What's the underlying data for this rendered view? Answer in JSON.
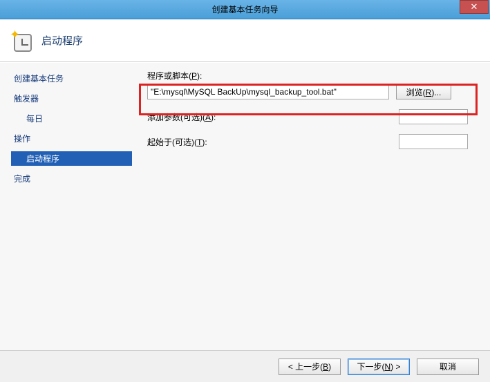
{
  "window": {
    "title": "创建基本任务向导"
  },
  "header": {
    "title": "启动程序"
  },
  "sidebar": {
    "items": [
      {
        "label": "创建基本任务"
      },
      {
        "label": "触发器"
      },
      {
        "label": "每日"
      },
      {
        "label": "操作"
      },
      {
        "label": "启动程序"
      },
      {
        "label": "完成"
      }
    ]
  },
  "content": {
    "program_label_pre": "程序或脚本(",
    "program_label_ak": "P",
    "program_label_post": "):",
    "program_value": "\"E:\\mysql\\MySQL BackUp\\mysql_backup_tool.bat\"",
    "browse_pre": "浏览(",
    "browse_ak": "R",
    "browse_post": ")...",
    "args_label_pre": "添加参数(可选)(",
    "args_label_ak": "A",
    "args_label_post": "):",
    "args_value": "",
    "startin_label_pre": "起始于(可选)(",
    "startin_label_ak": "T",
    "startin_label_post": "):",
    "startin_value": ""
  },
  "footer": {
    "back_pre": "< 上一步(",
    "back_ak": "B",
    "back_post": ")",
    "next_pre": "下一步(",
    "next_ak": "N",
    "next_post": ") >",
    "cancel": "取消"
  }
}
